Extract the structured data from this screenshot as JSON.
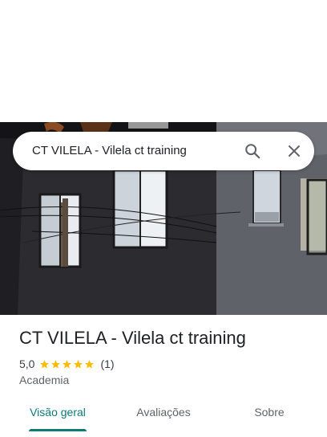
{
  "search": {
    "query": "CT VILELA - Vilela ct training",
    "search_icon": "search-icon",
    "close_icon": "close-icon"
  },
  "place": {
    "title": "CT VILELA - Vilela ct training",
    "rating": "5,0",
    "stars": 5,
    "review_count": "(1)",
    "category": "Academia"
  },
  "tabs": [
    {
      "label": "Visão geral",
      "active": true
    },
    {
      "label": "Avaliações",
      "active": false
    },
    {
      "label": "Sobre",
      "active": false
    }
  ],
  "colors": {
    "accent": "#0b7a78",
    "star": "#fbbc04",
    "text_primary": "#202124",
    "text_secondary": "#5f6368"
  }
}
